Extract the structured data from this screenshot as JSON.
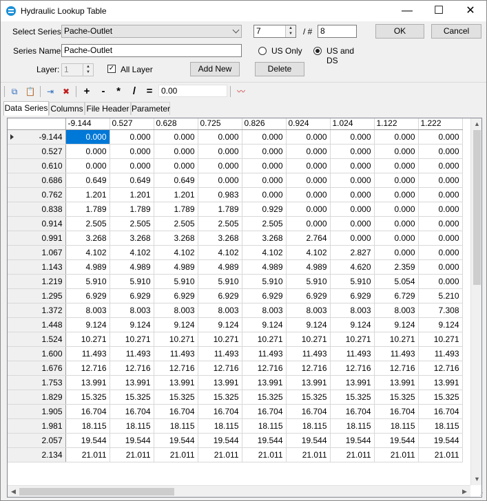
{
  "window": {
    "title": "Hydraulic Lookup Table",
    "minimize": "—",
    "maximize": "☐",
    "close": "✕"
  },
  "form": {
    "select_series_label": "Select Series:",
    "select_series_value": "Pache-Outlet",
    "series_index": "7",
    "series_sep": "/ #",
    "series_total": "8",
    "ok_label": "OK",
    "cancel_label": "Cancel",
    "series_name_label": "Series Name:",
    "series_name_value": "Pache-Outlet",
    "radio_us_only": "US Only",
    "radio_us_and_ds": "US and DS",
    "radio_selected": "US and DS",
    "layer_label": "Layer:",
    "layer_value": "1",
    "all_layer_label": "All Layer",
    "all_layer_checked": true,
    "add_new_label": "Add New",
    "delete_label": "Delete"
  },
  "toolbar": {
    "icons": [
      "copy-icon",
      "paste-icon",
      "insert-column-icon",
      "delete-column-icon",
      "curve-plot-icon"
    ],
    "ops": [
      "+",
      "-",
      "*",
      "/",
      "="
    ],
    "value": "0.00"
  },
  "tabs": [
    "Data Series",
    "Columns",
    "File Header",
    "Parameter"
  ],
  "active_tab": "Data Series",
  "grid": {
    "columns": [
      "-9.144",
      "0.527",
      "0.628",
      "0.725",
      "0.826",
      "0.924",
      "1.024",
      "1.122",
      "1.222"
    ],
    "rows": [
      {
        "h": "-9.144",
        "v": [
          "0.000",
          "0.000",
          "0.000",
          "0.000",
          "0.000",
          "0.000",
          "0.000",
          "0.000",
          "0.000"
        ]
      },
      {
        "h": "0.527",
        "v": [
          "0.000",
          "0.000",
          "0.000",
          "0.000",
          "0.000",
          "0.000",
          "0.000",
          "0.000",
          "0.000"
        ]
      },
      {
        "h": "0.610",
        "v": [
          "0.000",
          "0.000",
          "0.000",
          "0.000",
          "0.000",
          "0.000",
          "0.000",
          "0.000",
          "0.000"
        ]
      },
      {
        "h": "0.686",
        "v": [
          "0.649",
          "0.649",
          "0.649",
          "0.000",
          "0.000",
          "0.000",
          "0.000",
          "0.000",
          "0.000"
        ]
      },
      {
        "h": "0.762",
        "v": [
          "1.201",
          "1.201",
          "1.201",
          "0.983",
          "0.000",
          "0.000",
          "0.000",
          "0.000",
          "0.000"
        ]
      },
      {
        "h": "0.838",
        "v": [
          "1.789",
          "1.789",
          "1.789",
          "1.789",
          "0.929",
          "0.000",
          "0.000",
          "0.000",
          "0.000"
        ]
      },
      {
        "h": "0.914",
        "v": [
          "2.505",
          "2.505",
          "2.505",
          "2.505",
          "2.505",
          "0.000",
          "0.000",
          "0.000",
          "0.000"
        ]
      },
      {
        "h": "0.991",
        "v": [
          "3.268",
          "3.268",
          "3.268",
          "3.268",
          "3.268",
          "2.764",
          "0.000",
          "0.000",
          "0.000"
        ]
      },
      {
        "h": "1.067",
        "v": [
          "4.102",
          "4.102",
          "4.102",
          "4.102",
          "4.102",
          "4.102",
          "2.827",
          "0.000",
          "0.000"
        ]
      },
      {
        "h": "1.143",
        "v": [
          "4.989",
          "4.989",
          "4.989",
          "4.989",
          "4.989",
          "4.989",
          "4.620",
          "2.359",
          "0.000"
        ]
      },
      {
        "h": "1.219",
        "v": [
          "5.910",
          "5.910",
          "5.910",
          "5.910",
          "5.910",
          "5.910",
          "5.910",
          "5.054",
          "0.000"
        ]
      },
      {
        "h": "1.295",
        "v": [
          "6.929",
          "6.929",
          "6.929",
          "6.929",
          "6.929",
          "6.929",
          "6.929",
          "6.729",
          "5.210"
        ]
      },
      {
        "h": "1.372",
        "v": [
          "8.003",
          "8.003",
          "8.003",
          "8.003",
          "8.003",
          "8.003",
          "8.003",
          "8.003",
          "7.308"
        ]
      },
      {
        "h": "1.448",
        "v": [
          "9.124",
          "9.124",
          "9.124",
          "9.124",
          "9.124",
          "9.124",
          "9.124",
          "9.124",
          "9.124"
        ]
      },
      {
        "h": "1.524",
        "v": [
          "10.271",
          "10.271",
          "10.271",
          "10.271",
          "10.271",
          "10.271",
          "10.271",
          "10.271",
          "10.271"
        ]
      },
      {
        "h": "1.600",
        "v": [
          "11.493",
          "11.493",
          "11.493",
          "11.493",
          "11.493",
          "11.493",
          "11.493",
          "11.493",
          "11.493"
        ]
      },
      {
        "h": "1.676",
        "v": [
          "12.716",
          "12.716",
          "12.716",
          "12.716",
          "12.716",
          "12.716",
          "12.716",
          "12.716",
          "12.716"
        ]
      },
      {
        "h": "1.753",
        "v": [
          "13.991",
          "13.991",
          "13.991",
          "13.991",
          "13.991",
          "13.991",
          "13.991",
          "13.991",
          "13.991"
        ]
      },
      {
        "h": "1.829",
        "v": [
          "15.325",
          "15.325",
          "15.325",
          "15.325",
          "15.325",
          "15.325",
          "15.325",
          "15.325",
          "15.325"
        ]
      },
      {
        "h": "1.905",
        "v": [
          "16.704",
          "16.704",
          "16.704",
          "16.704",
          "16.704",
          "16.704",
          "16.704",
          "16.704",
          "16.704"
        ]
      },
      {
        "h": "1.981",
        "v": [
          "18.115",
          "18.115",
          "18.115",
          "18.115",
          "18.115",
          "18.115",
          "18.115",
          "18.115",
          "18.115"
        ]
      },
      {
        "h": "2.057",
        "v": [
          "19.544",
          "19.544",
          "19.544",
          "19.544",
          "19.544",
          "19.544",
          "19.544",
          "19.544",
          "19.544"
        ]
      },
      {
        "h": "2.134",
        "v": [
          "21.011",
          "21.011",
          "21.011",
          "21.011",
          "21.011",
          "21.011",
          "21.011",
          "21.011",
          "21.011"
        ]
      }
    ]
  },
  "colors": {
    "selection": "#0078d7",
    "app_icon": "#1a8fd6"
  }
}
